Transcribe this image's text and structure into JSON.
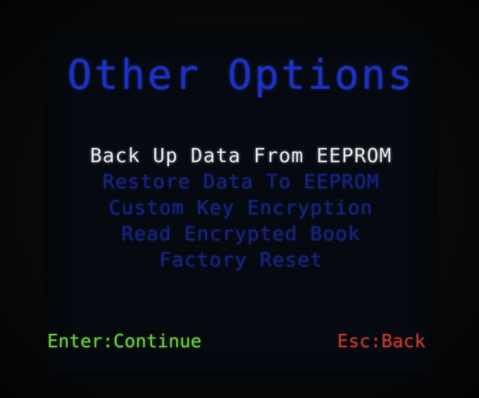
{
  "title": "Other Options",
  "menu": {
    "items": [
      {
        "label": "Back Up Data From EEPROM",
        "selected": true
      },
      {
        "label": "Restore Data To EEPROM",
        "selected": false
      },
      {
        "label": "Custom Key Encryption",
        "selected": false
      },
      {
        "label": "Read Encrypted Book",
        "selected": false
      },
      {
        "label": "Factory Reset",
        "selected": false
      }
    ]
  },
  "footer": {
    "enter_hint": "Enter:Continue",
    "esc_hint": "Esc:Back"
  },
  "colors": {
    "title": "#1a2fc4",
    "selected_item": "#e8e8ee",
    "unselected_item": "#13207e",
    "enter_hint": "#6fcf3d",
    "esc_hint": "#c0392b",
    "screen_background": "#03070d"
  }
}
